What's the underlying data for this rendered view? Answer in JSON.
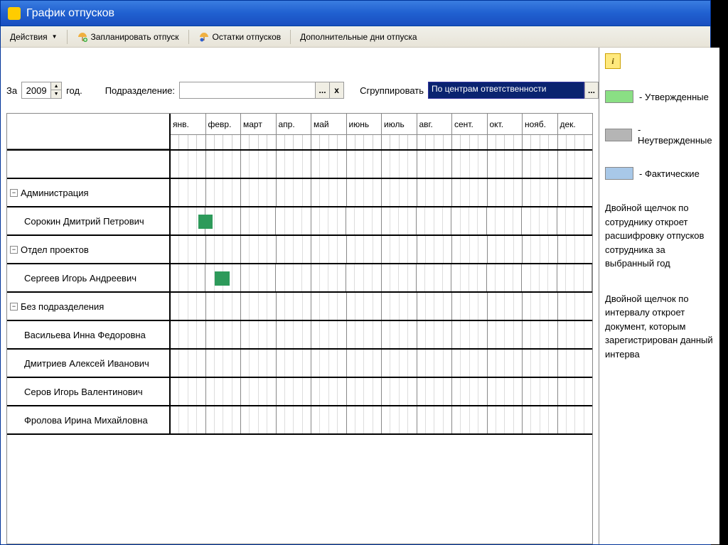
{
  "window": {
    "title": "График отпусков"
  },
  "toolbar": {
    "actions": "Действия",
    "plan_vacation": "Запланировать отпуск",
    "vacation_balance": "Остатки отпусков",
    "additional_days": "Дополнительные дни отпуска"
  },
  "filters": {
    "for_label": "За",
    "year": "2009",
    "year_suffix": "год.",
    "dept_label": "Подразделение:",
    "dept_value": "",
    "ellipsis": "...",
    "clear": "x",
    "group_label": "Сгруппировать",
    "group_value": "По центрам ответственности"
  },
  "months": [
    "янв.",
    "февр.",
    "март",
    "апр.",
    "май",
    "июнь",
    "июль",
    "авг.",
    "сент.",
    "окт.",
    "нояб.",
    "дек."
  ],
  "rows": [
    {
      "type": "group",
      "label": "Администрация"
    },
    {
      "type": "person",
      "label": "Сорокин Дмитрий Петрович",
      "bar": {
        "left_pct": 6.5,
        "width_pct": 3.5,
        "color": "#2d9a5a"
      }
    },
    {
      "type": "group",
      "label": "Отдел проектов"
    },
    {
      "type": "person",
      "label": "Сергеев Игорь Андреевич",
      "bar": {
        "left_pct": 10.5,
        "width_pct": 3.5,
        "color": "#2d9a5a"
      }
    },
    {
      "type": "group",
      "label": "Без подразделения"
    },
    {
      "type": "person",
      "label": "Васильева Инна Федоровна"
    },
    {
      "type": "person",
      "label": "Дмитриев Алексей Иванович"
    },
    {
      "type": "person",
      "label": "Серов Игорь Валентинович"
    },
    {
      "type": "person",
      "label": "Фролова Ирина Михайловна"
    }
  ],
  "legend": {
    "approved": "- Утвержденные",
    "unapproved": "- Неутвержденные",
    "actual": "- Фактические"
  },
  "help": {
    "line1": "Двойной щелчок по сотруднику откроет расшифровку отпусков сотрудника за выбранный год",
    "line2": "Двойной щелчок по интервалу откроет документ, которым зарегистрирован данный интерва"
  },
  "info_icon": "i"
}
